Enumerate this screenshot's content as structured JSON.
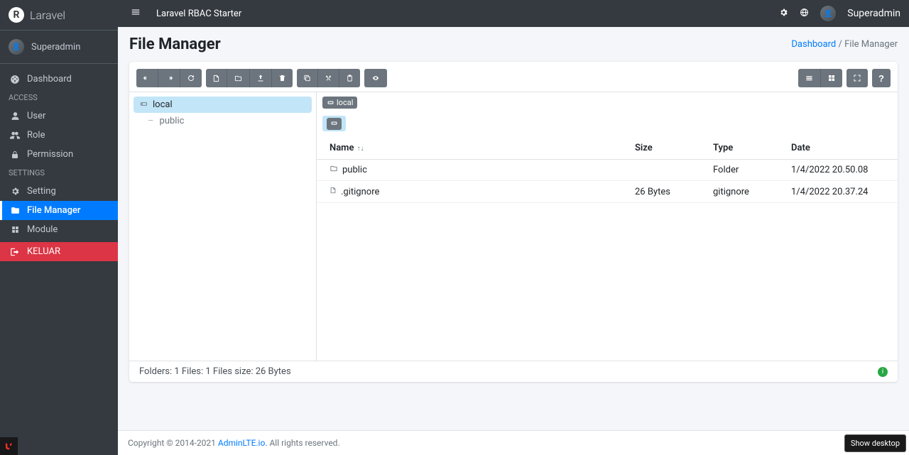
{
  "brand": {
    "name": "Laravel",
    "logo_letter": "R"
  },
  "user": {
    "name": "Superadmin"
  },
  "topbar": {
    "title": "Laravel RBAC Starter",
    "user_name": "Superadmin"
  },
  "page": {
    "title": "File Manager"
  },
  "breadcrumb": {
    "root": "Dashboard",
    "sep": "/",
    "current": "File Manager"
  },
  "sidebar": {
    "dashboard": "Dashboard",
    "section_access": "ACCESS",
    "user": "User",
    "role": "Role",
    "permission": "Permission",
    "section_settings": "SETTINGS",
    "setting": "Setting",
    "file_manager": "File Manager",
    "module": "Module",
    "logout": "KELUAR"
  },
  "fm": {
    "disk_label": "local",
    "tree": {
      "root": "local",
      "child": "public"
    },
    "columns": {
      "name": "Name",
      "size": "Size",
      "type": "Type",
      "date": "Date"
    },
    "rows": [
      {
        "icon": "folder",
        "name": "public",
        "size": "",
        "type": "Folder",
        "date": "1/4/2022 20.50.08"
      },
      {
        "icon": "file",
        "name": ".gitignore",
        "size": "26 Bytes",
        "type": "gitignore",
        "date": "1/4/2022 20.37.24"
      }
    ],
    "status": "Folders: 1 Files: 1 Files size: 26 Bytes"
  },
  "footer": {
    "prefix": "Copyright © 2014-2021 ",
    "link": "AdminLTE.io.",
    "suffix": " All rights reserved."
  },
  "tooltip": "Show desktop"
}
